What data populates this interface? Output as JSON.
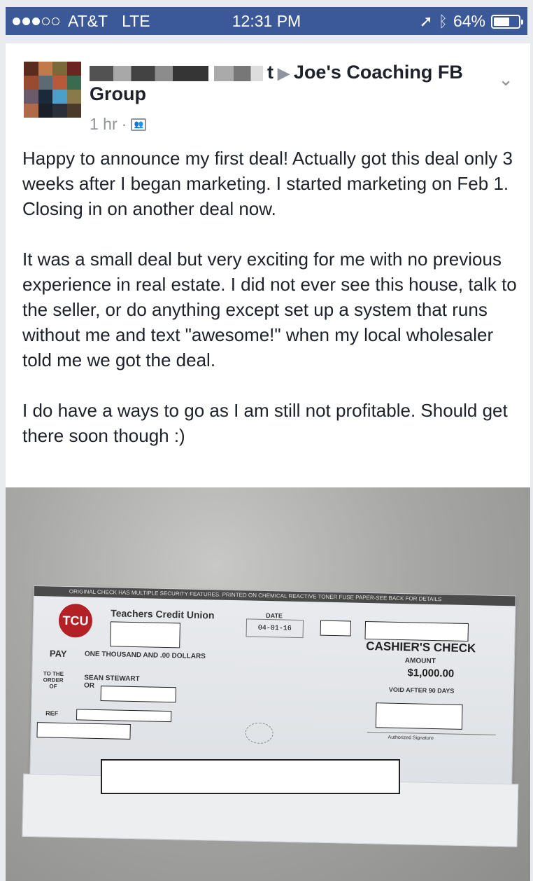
{
  "status_bar": {
    "carrier": "AT&T",
    "network": "LTE",
    "time": "12:31 PM",
    "battery": "64%",
    "battery_level": 0.64,
    "signal_bars_filled": 3,
    "signal_bars_total": 5
  },
  "post": {
    "author_redacted": true,
    "author_tail": "t",
    "target": "Joe's Coaching FB Group",
    "time": "1 hr",
    "audience_icon": "group-icon",
    "paragraphs": [
      "Happy to announce my first deal! Actually got this deal only 3 weeks after I began marketing. I started marketing on Feb 1. Closing in on another deal now.",
      "It was a small deal but very exciting for me with no previous experience in real estate. I did not ever see this house, talk to the seller, or do anything except set up a system that runs without me and text \"awesome!\" when my local wholesaler told me we got the deal.",
      "I do have a ways to go as I am still not profitable. Should get there soon though :)"
    ]
  },
  "check": {
    "top_band": "ORIGINAL CHECK HAS MULTIPLE SECURITY FEATURES. PRINTED ON CHEMICAL REACTIVE TONER FUSE PAPER-SEE BACK FOR DETAILS",
    "logo": "TCU",
    "bank": "Teachers Credit Union",
    "date_label": "DATE",
    "date": "04-01-16",
    "title": "CASHIER'S CHECK",
    "pay_label": "PAY",
    "amount_words": "ONE THOUSAND AND .00 DOLLARS",
    "amount_label": "AMOUNT",
    "amount": "$1,000.00",
    "order_label": "TO THE ORDER OF",
    "payee": "SEAN STEWART",
    "payee_or": "OR",
    "void_note": "VOID AFTER 90 DAYS",
    "ref_label": "REF",
    "signature_label": "Authorized Signature"
  }
}
